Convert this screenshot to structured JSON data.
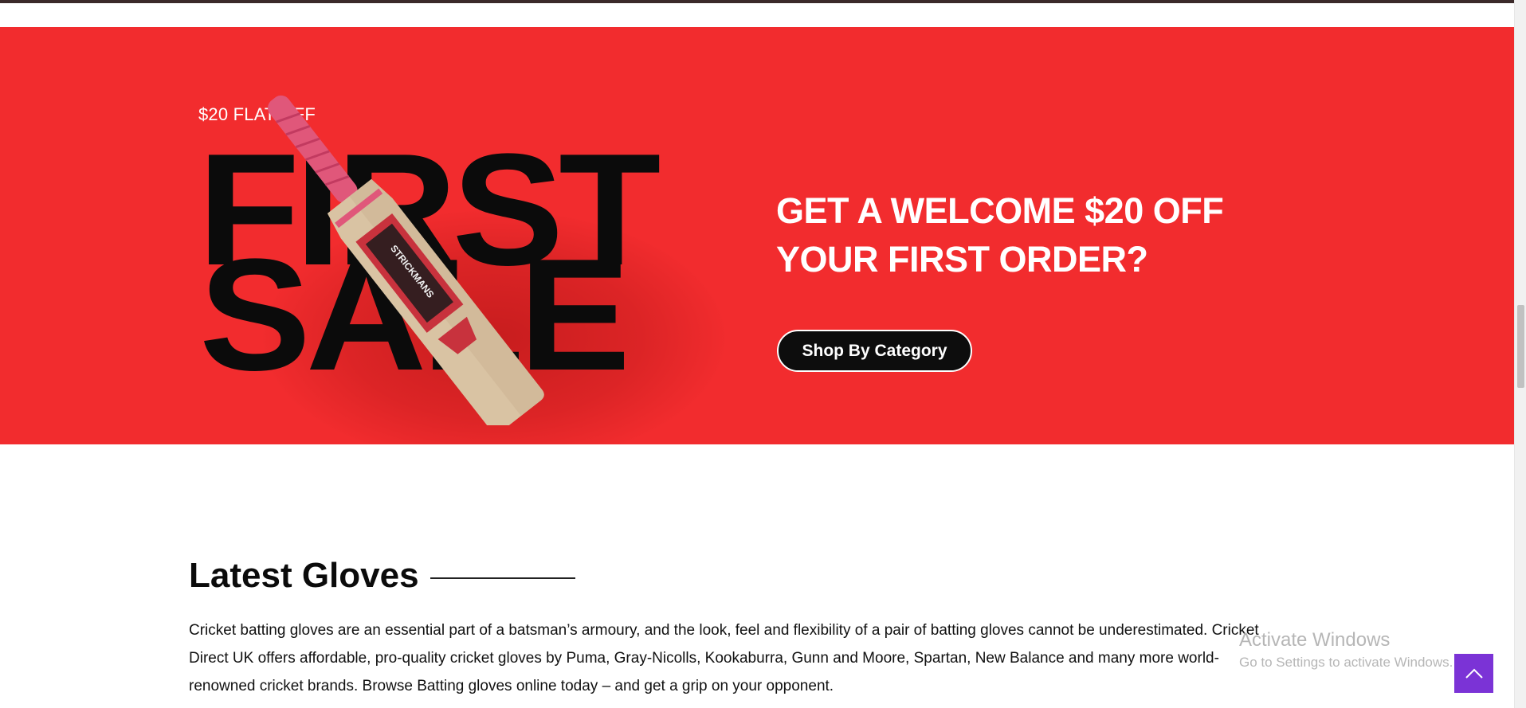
{
  "hero": {
    "flat_off": "$20 FLAT OFF",
    "big_line1": "FIRST",
    "big_line2": "SALE",
    "heading_line1": "GET A WELCOME $20 OFF",
    "heading_line2": "YOUR FIRST ORDER?",
    "cta_label": "Shop By Category",
    "bat_brand": "STRICKMANS",
    "bg_color": "#f22c2e"
  },
  "section": {
    "title": "Latest Gloves",
    "body": "Cricket batting gloves are an essential part of a batsman’s armoury, and the look, feel and flexibility of a pair of batting gloves cannot be underestimated. Cricket Direct UK offers affordable, pro-quality cricket gloves by Puma, Gray-Nicolls, Kookaburra, Gunn and Moore, Spartan, New Balance and many more world-renowned cricket brands. Browse Batting gloves online today – and get a grip on your opponent."
  },
  "overlay": {
    "activate_title": "Activate Windows",
    "activate_sub": "Go to Settings to activate Windows."
  },
  "icons": {
    "scroll_top": "chevron-up-icon",
    "accent_color": "#7b33d6"
  }
}
